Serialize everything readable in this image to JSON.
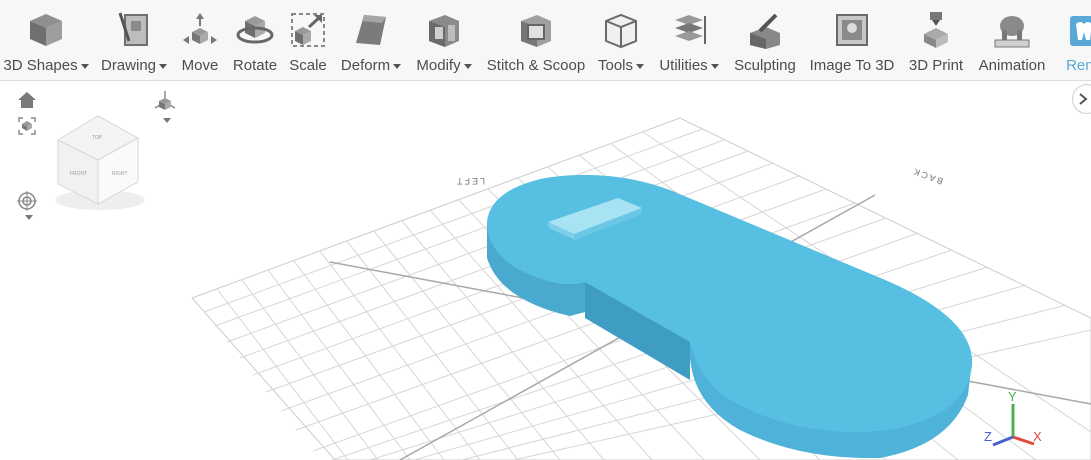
{
  "toolbar": {
    "items": [
      {
        "label": "3D Shapes",
        "dropdown": true,
        "icon": "cube-icon"
      },
      {
        "label": "Drawing",
        "dropdown": true,
        "icon": "drawing-icon"
      },
      {
        "label": "Move",
        "dropdown": false,
        "icon": "move-icon"
      },
      {
        "label": "Rotate",
        "dropdown": false,
        "icon": "rotate-icon"
      },
      {
        "label": "Scale",
        "dropdown": false,
        "icon": "scale-icon"
      },
      {
        "label": "Deform",
        "dropdown": true,
        "icon": "deform-icon"
      },
      {
        "label": "Modify",
        "dropdown": true,
        "icon": "modify-icon"
      },
      {
        "label": "Stitch & Scoop",
        "dropdown": false,
        "icon": "stitch-scoop-icon"
      },
      {
        "label": "Tools",
        "dropdown": true,
        "icon": "tools-icon"
      },
      {
        "label": "Utilities",
        "dropdown": true,
        "icon": "utilities-icon"
      },
      {
        "label": "Sculpting",
        "dropdown": false,
        "icon": "sculpting-icon"
      },
      {
        "label": "Image To 3D",
        "dropdown": false,
        "icon": "image-to-3d-icon"
      },
      {
        "label": "3D Print",
        "dropdown": false,
        "icon": "3d-print-icon"
      },
      {
        "label": "Animation",
        "dropdown": false,
        "icon": "animation-icon"
      },
      {
        "label": "Rend",
        "dropdown": false,
        "icon": "render-icon"
      }
    ]
  },
  "viewcube": {
    "top": "TOP",
    "front": "FRONT",
    "right": "RIGHT"
  },
  "grid_labels": {
    "left": "LEFT",
    "back": "BACK"
  },
  "axes": {
    "x": "X",
    "y": "Y",
    "z": "Z"
  },
  "colors": {
    "toolbar_bg": "#f7f7f7",
    "text": "#4d4d4d",
    "active": "#5aa8d8",
    "model_top": "#55bfe0",
    "model_side": "#4aa9cf",
    "grid": "#d4d4d4",
    "axis_x": "#e14b3b",
    "axis_y": "#4caf50",
    "axis_z": "#4a5fd0"
  }
}
